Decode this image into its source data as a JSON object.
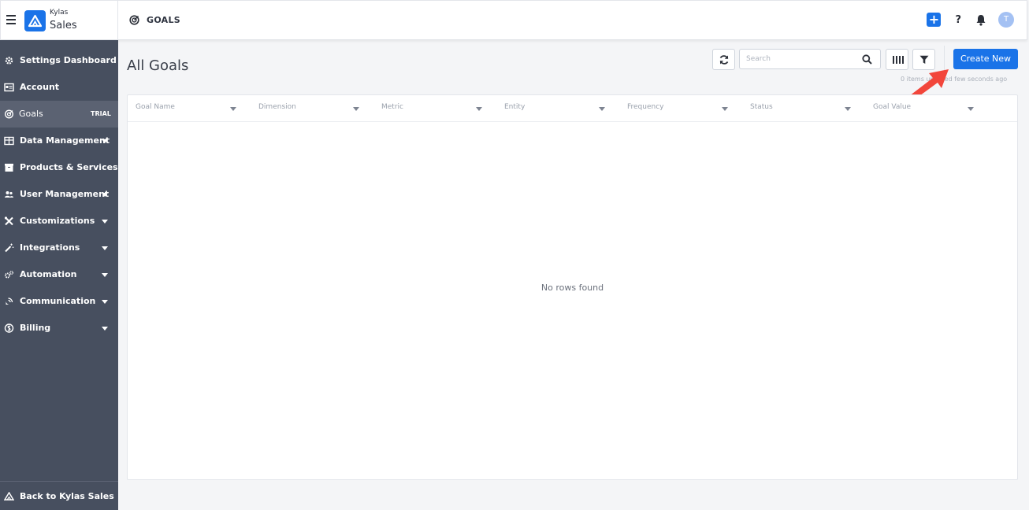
{
  "header": {
    "brand_top": "Kylas",
    "brand_bottom": "Sales",
    "breadcrumb": "GOALS",
    "help_label": "?",
    "avatar_initial": "T",
    "accent_color": "#1a73e8"
  },
  "sidebar": {
    "items": [
      {
        "label": "Settings Dashboard",
        "icon": "gear-icon"
      },
      {
        "label": "Account",
        "icon": "id-card-icon"
      },
      {
        "label": "Goals",
        "icon": "target-icon",
        "badge": "TRIAL",
        "active": true
      },
      {
        "label": "Data Management",
        "icon": "table-icon",
        "expandable": true
      },
      {
        "label": "Products & Services",
        "icon": "box-icon"
      },
      {
        "label": "User Management",
        "icon": "users-icon",
        "expandable": true
      },
      {
        "label": "Customizations",
        "icon": "tools-icon",
        "expandable": true
      },
      {
        "label": "Integrations",
        "icon": "wand-icon",
        "expandable": true
      },
      {
        "label": "Automation",
        "icon": "cogs-icon",
        "expandable": true
      },
      {
        "label": "Communication",
        "icon": "satellite-icon",
        "expandable": true
      },
      {
        "label": "Billing",
        "icon": "coin-icon",
        "expandable": true
      }
    ],
    "back_label": "Back to Kylas Sales"
  },
  "main": {
    "title": "All Goals",
    "search_placeholder": "Search",
    "create_label": "Create New",
    "updated_text": "0 items  updated few seconds ago",
    "columns": [
      "Goal Name",
      "Dimension",
      "Metric",
      "Entity",
      "Frequency",
      "Status",
      "Goal Value"
    ],
    "empty_text": "No rows found"
  }
}
